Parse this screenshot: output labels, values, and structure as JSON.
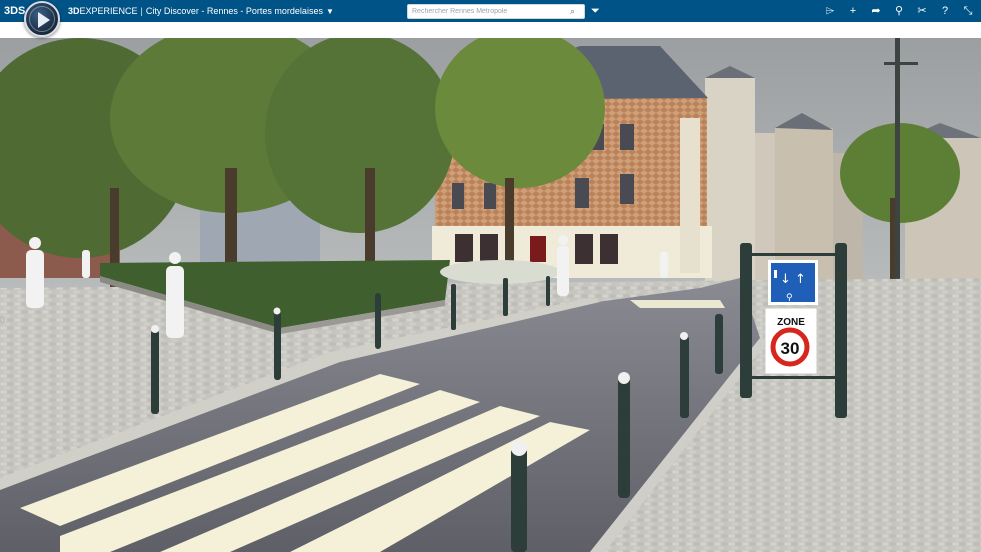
{
  "app": {
    "brand": "3DEXPERIENCE",
    "brand_bold": "3D",
    "brand_rest": "EXPERIENCE",
    "separator": "|",
    "app_name": "City Discover - Rennes - Portes mordelaises",
    "logo_glyph": "3DS"
  },
  "search": {
    "placeholder": "Rechercher Rennes Métropole",
    "icon": "search-icon"
  },
  "toolbar": {
    "tools": [
      {
        "name": "bookmark-tag-icon",
        "glyph": "⌲"
      },
      {
        "name": "add-icon",
        "glyph": "+"
      },
      {
        "name": "share-icon",
        "glyph": "➦"
      },
      {
        "name": "network-share-icon",
        "glyph": "⚲"
      },
      {
        "name": "tools-icon",
        "glyph": "✂"
      },
      {
        "name": "help-icon",
        "glyph": "?"
      },
      {
        "name": "collapse-icon",
        "glyph": "⤡"
      }
    ]
  },
  "scene": {
    "sign_top": "↓ ↑",
    "sign_zone": "ZONE",
    "sign_speed": "30"
  },
  "colors": {
    "topbar": "#005386",
    "sky": "#a7abad",
    "road": "#6f6f78",
    "crosswalk": "#f4f1d8",
    "bollard": "#2d3d3a",
    "sign_blue": "#1f5fb8",
    "sign_red": "#d7261e"
  }
}
